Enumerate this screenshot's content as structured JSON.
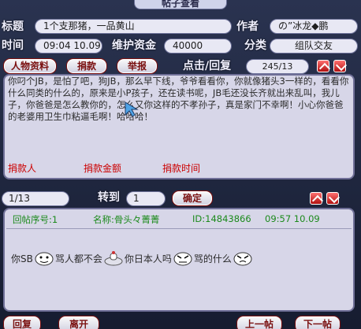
{
  "window": {
    "title": "帖子查看"
  },
  "header": {
    "subject_label": "标题",
    "subject_value": "1个支那猪，一品黄山",
    "author_label": "作者",
    "author_value": "の”冰龙◆鹏",
    "time_label": "时间",
    "time_value": "09:04 10.09",
    "fund_label": "维护资金",
    "fund_value": "40000",
    "category_label": "分类",
    "category_value": "组队交友"
  },
  "toolbar": {
    "profile_label": "人物资料",
    "donate_label": "捐款",
    "report_label": "举报",
    "clicks_label": "点击/回复",
    "clicks_value": "245/13"
  },
  "post": {
    "content": "你叼个JB，是怕了吧，狗JB，那么早下线，爷爷看看你，你就像猪头3一样的，看看你什么同类的什么的，原来是小P孩子，还在读书呢，JB毛还没长齐就出来乱叫，我儿子，你爸爸是怎么教你的，怎么又你这样的不孝孙子，真是家门不幸啊！小心你爸爸的老婆用卫生巾粘逼毛啊！哈哈哈！"
  },
  "donations": {
    "donor_col": "捐款人",
    "amount_col": "捐款金额",
    "time_col": "捐款时间"
  },
  "pager": {
    "page_value": "1/13",
    "goto_label": "转到",
    "goto_value": "1",
    "confirm_label": "确定"
  },
  "reply": {
    "seq": "回帖序号:1",
    "name": "名称:骨头々菁菁",
    "id": "ID:14843866",
    "time": "09:57 10.09",
    "text_1": "你SB",
    "text_2": "骂人都不会",
    "text_3": "你日本人吗",
    "text_4": "骂的什么"
  },
  "footer": {
    "reply_label": "回复",
    "leave_label": "离开",
    "prev_label": "上一帖",
    "next_label": "下一帖"
  }
}
